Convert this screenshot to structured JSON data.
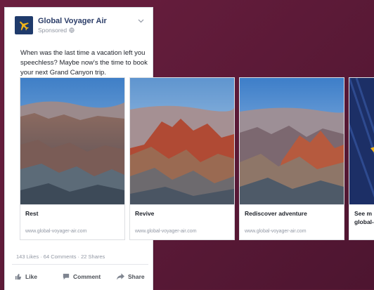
{
  "post": {
    "page_name": "Global Voyager Air",
    "sponsored": "Sponsored",
    "text": "When was the last time a vacation left you speechless? Maybe now's the time to book your next Grand Canyon trip.",
    "stats": "143 Likes · 64 Comments · 22 Shares"
  },
  "carousel": {
    "cards": [
      {
        "title": "Rest",
        "url": "www.global-voyager-air.com"
      },
      {
        "title": "Revive",
        "url": "www.global-voyager-air.com"
      },
      {
        "title": "Rediscover adventure",
        "url": "www.global-voyager-air.com"
      },
      {
        "title": "See m",
        "title2": "global-"
      }
    ]
  },
  "actions": {
    "like": "Like",
    "comment": "Comment",
    "share": "Share"
  },
  "colors": {
    "backdrop": "#5a1a36",
    "brand_blue": "#2b3d68",
    "logo_bg": "#1f3a6b",
    "logo_plane": "#f2b51a"
  }
}
